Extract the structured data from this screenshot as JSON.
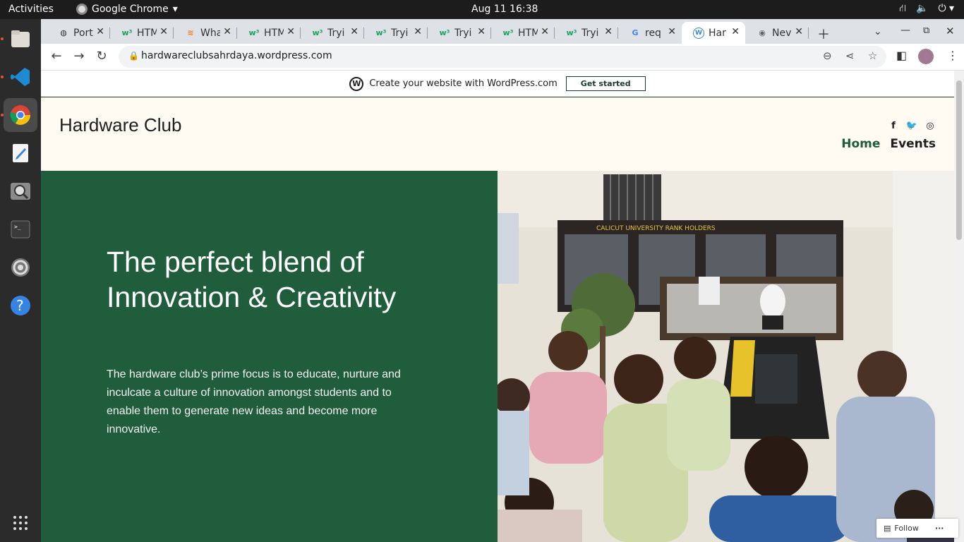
{
  "system": {
    "activities": "Activities",
    "app_name": "Google Chrome",
    "clock": "Aug 11  16:38"
  },
  "tabs": [
    {
      "label": "Port",
      "icon": "globe-icon"
    },
    {
      "label": "HTM",
      "icon": "w3schools-icon"
    },
    {
      "label": "Wha",
      "icon": "stack-icon"
    },
    {
      "label": "HTM",
      "icon": "w3schools-icon"
    },
    {
      "label": "Tryi",
      "icon": "w3schools-icon"
    },
    {
      "label": "Tryi",
      "icon": "w3schools-icon"
    },
    {
      "label": "Tryi",
      "icon": "w3schools-icon"
    },
    {
      "label": "HTM",
      "icon": "w3schools-icon"
    },
    {
      "label": "Tryi",
      "icon": "w3schools-icon"
    },
    {
      "label": "req",
      "icon": "google-icon"
    },
    {
      "label": "Har",
      "icon": "wordpress-icon",
      "active": true
    },
    {
      "label": "Nev",
      "icon": "chrome-icon"
    }
  ],
  "toolbar": {
    "url": "hardwareclubsahrdaya.wordpress.com"
  },
  "page": {
    "banner_text": "Create your website with WordPress.com",
    "banner_button": "Get started",
    "site_title": "Hardware Club",
    "nav": {
      "home": "Home",
      "events": "Events"
    },
    "hero_title": "The perfect blend of Innovation & Creativity",
    "hero_text": "The hardware club’s prime focus is to educate, nurture and inculcate a culture of innovation amongst students and to enable them to generate new ideas and become more innovative.",
    "photo_sign": "CALICUT UNIVERSITY RANK HOLDERS",
    "follow_label": "Follow"
  },
  "colors": {
    "hero_green": "#205d3c",
    "header_bg": "#fffbf2",
    "nav_active": "#1f5c3a"
  }
}
